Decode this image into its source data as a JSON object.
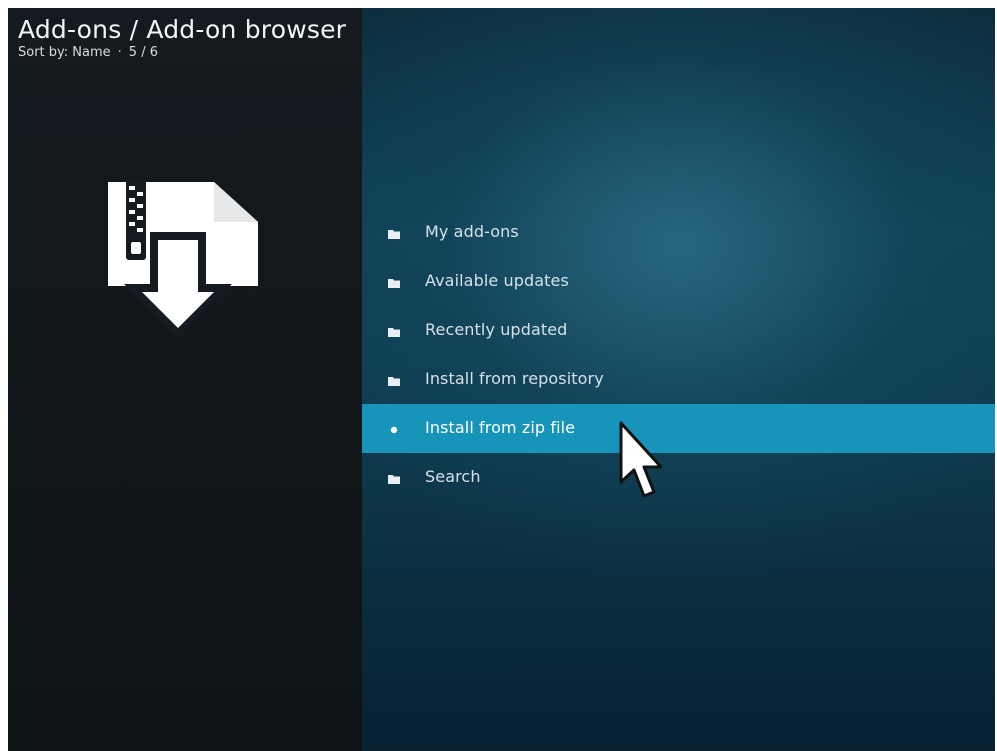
{
  "header": {
    "title": "Add-ons / Add-on browser",
    "sort_label": "Sort by: Name",
    "separator": "·",
    "position": "5 / 6"
  },
  "art": {
    "icon": "zip-file-download-icon"
  },
  "menu": {
    "items": [
      {
        "label": "My add-ons",
        "icon": "folder-icon"
      },
      {
        "label": "Available updates",
        "icon": "folder-icon"
      },
      {
        "label": "Recently updated",
        "icon": "folder-icon"
      },
      {
        "label": "Install from repository",
        "icon": "folder-icon"
      },
      {
        "label": "Install from zip file",
        "icon": "dot-icon",
        "focused": true
      },
      {
        "label": "Search",
        "icon": "folder-icon"
      }
    ]
  },
  "colors": {
    "focus_highlight": "#1694ba",
    "left_panel": "#121719",
    "right_panel": "#0f4257",
    "text": "#d6e1e7"
  }
}
